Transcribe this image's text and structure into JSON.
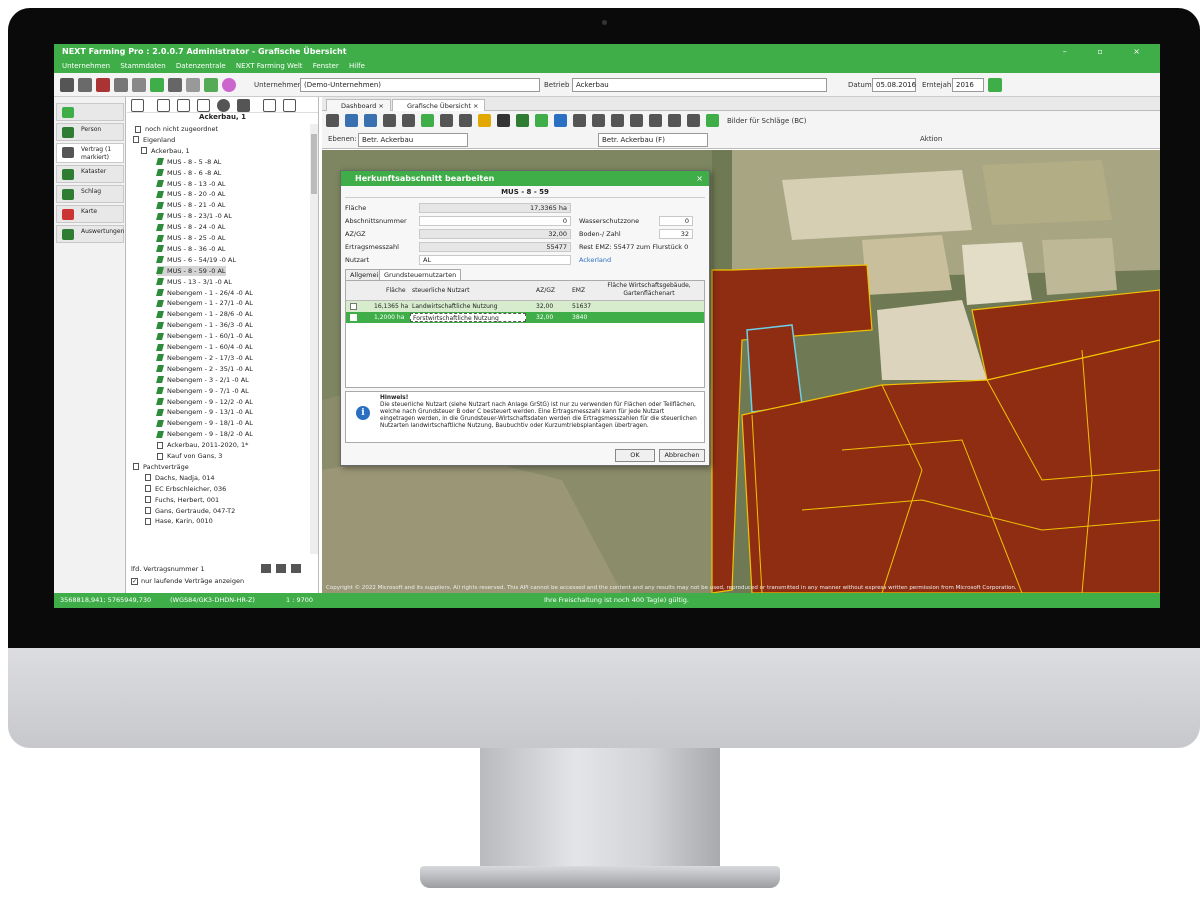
{
  "app": {
    "title": "NEXT Farming Pro : 2.0.0.7 Administrator - Grafische Übersicht",
    "window_buttons": "–  ▫  ×",
    "menu": [
      "Unternehmen",
      "Stammdaten",
      "Datenzentrale",
      "NEXT Farming Welt",
      "Fenster",
      "Hilfe"
    ]
  },
  "toolbar": {
    "unternehmen_label": "Unternehmen",
    "unternehmen_value": "(Demo-Unternehmen)",
    "betrieb_label": "Betrieb",
    "betrieb_value": "Ackerbau",
    "datum_label": "Datum",
    "datum_value": "05.08.2016",
    "erntejahr_label": "Erntejahr",
    "erntejahr_value": "2016"
  },
  "nav": {
    "items": [
      {
        "label": "Person",
        "icon": "person-icon"
      },
      {
        "label": "Vertrag (1 markiert)",
        "icon": "contract-icon"
      },
      {
        "label": "Kataster",
        "icon": "cadastre-icon"
      },
      {
        "label": "Schlag",
        "icon": "field-icon"
      },
      {
        "label": "Karte",
        "icon": "map-icon"
      },
      {
        "label": "Auswertungen",
        "icon": "chart-icon"
      }
    ]
  },
  "tree": {
    "header": "Ackerbau, 1",
    "rows": [
      "noch nicht zugeordnet",
      "Eigenland",
      "Ackerbau, 1",
      "MUS - 8 - 5 -8 AL",
      "MUS - 8 - 6 -8 AL",
      "MUS - 8 - 13 -0 AL",
      "MUS - 8 - 20 -0 AL",
      "MUS - 8 - 21 -0 AL",
      "MUS - 8 - 23/1 -0 AL",
      "MUS - 8 - 24 -0 AL",
      "MUS - 8 - 25 -0 AL",
      "MUS - 8 - 36 -0 AL",
      "MUS - 6 - 54/19 -0 AL",
      "MUS - 8 - 59 -0 AL",
      "MUS - 13 - 3/1 -0 AL",
      "Nebengem - 1 - 26/4 -0 AL",
      "Nebengem - 1 - 27/1 -0 AL",
      "Nebengem - 1 - 28/6 -0 AL",
      "Nebengem - 1 - 36/3 -0 AL",
      "Nebengem - 1 - 60/1 -0 AL",
      "Nebengem - 1 - 60/4 -0 AL",
      "Nebengem - 2 - 17/3 -0 AL",
      "Nebengem - 2 - 35/1 -0 AL",
      "Nebengem - 3 - 2/1 -0 AL",
      "Nebengem - 9 - 7/1 -0 AL",
      "Nebengem - 9 - 12/2 -0 AL",
      "Nebengem - 9 - 13/1 -0 AL",
      "Nebengem - 9 - 18/1 -0 AL",
      "Nebengem - 9 - 18/2 -0 AL",
      "Ackerbau, 2011-2020, 1*",
      "Kauf von Gans, 3",
      "Pachtverträge",
      "Dachs, Nadja, 014",
      "EC Erbschleicher, 036",
      "Fuchs, Herbert, 001",
      "Gans, Gertraude, 047-T2",
      "Hase, Karin, 0010"
    ],
    "footer_label": "lfd. Vertragsnummer 1",
    "checkbox_label": "nur laufende Verträge anzeigen"
  },
  "tabs": [
    "Dashboard",
    "Grafische Übersicht"
  ],
  "map_tools": {
    "ebenen_label": "Ebenen:",
    "ebenen_value": "Betr. Ackerbau",
    "betr_value": "Betr. Ackerbau (F)",
    "bilder_label": "Bilder für Schläge (BC)",
    "aktion_label": "Aktion"
  },
  "dialog": {
    "title": "Herkunftsabschnitt bearbeiten",
    "subtitle": "MUS - 8 - 59",
    "fields": {
      "flaeche_label": "Fläche",
      "flaeche_value": "17,3365 ha",
      "abschnitt_label": "Abschnittsnummer",
      "abschnitt_value": "0",
      "azgz_label": "AZ/GZ",
      "azgz_value": "32,00",
      "ertrag_label": "Ertragsmesszahl",
      "ertrag_value": "55477",
      "nutzart_label": "Nutzart",
      "nutzart_value": "AL",
      "nutzart_text": "Ackerland",
      "wasser_label": "Wasserschutzzone",
      "wasser_value": "0",
      "bodenzahl_label": "Boden-/ Zahl",
      "bodenzahl_value": "32",
      "rest_label": "Rest EMZ: 55477 zum Flurstück 0"
    },
    "tabs": [
      "Allgemein",
      "Grundsteuernutzarten"
    ],
    "grid_headers": [
      "Fläche",
      "steuerliche Nutzart",
      "AZ/GZ",
      "EMZ",
      "Fläche Wirtschaftsgebäude, Gartenflächenart"
    ],
    "grid_rows": [
      {
        "flaeche": "16,1365 ha",
        "nutzart": "Landwirtschaftliche Nutzung",
        "azgz": "32,00",
        "emz": "51637"
      },
      {
        "flaeche": "1,2000 ha",
        "nutzart": "Forstwirtschaftliche Nutzung",
        "azgz": "32,00",
        "emz": "3840"
      }
    ],
    "hint_title": "Hinweis!",
    "hint_text": "Die steuerliche Nutzart (siehe Nutzart nach Anlage GrStG) ist nur zu verwenden für Flächen oder Teilflächen, welche nach Grundsteuer B oder C besteuert werden. Eine Ertragsmesszahl kann für jede Nutzart eingetragen werden, in die Grundsteuer-Wirtschaftsdaten werden die Ertragsmesszahlen für die steuerlichen Nutzarten landwirtschaftliche Nutzung, Baubuchtiv oder Kurzumtriebsplantagen übertragen.",
    "ok_label": "OK",
    "cancel_label": "Abbrechen"
  },
  "map": {
    "copyright": "Copyright © 2022 Microsoft and its suppliers. All rights reserved. This API cannot be accessed and the content and any results may not be used, reproduced or transmitted in any manner without express written permission from Microsoft Corporation."
  },
  "status": {
    "coords": "3568818,941; 5765949,730",
    "crs": "(WGS84/GK3-DHDN-HR-Z)",
    "scale": "1 : 9700",
    "message": "Ihre Freischaltung ist noch 400 Tag(e) gültig."
  },
  "colors": {
    "brand_green": "#3fae49",
    "field_red": "#8e2c12",
    "field_border": "#f2c200"
  }
}
